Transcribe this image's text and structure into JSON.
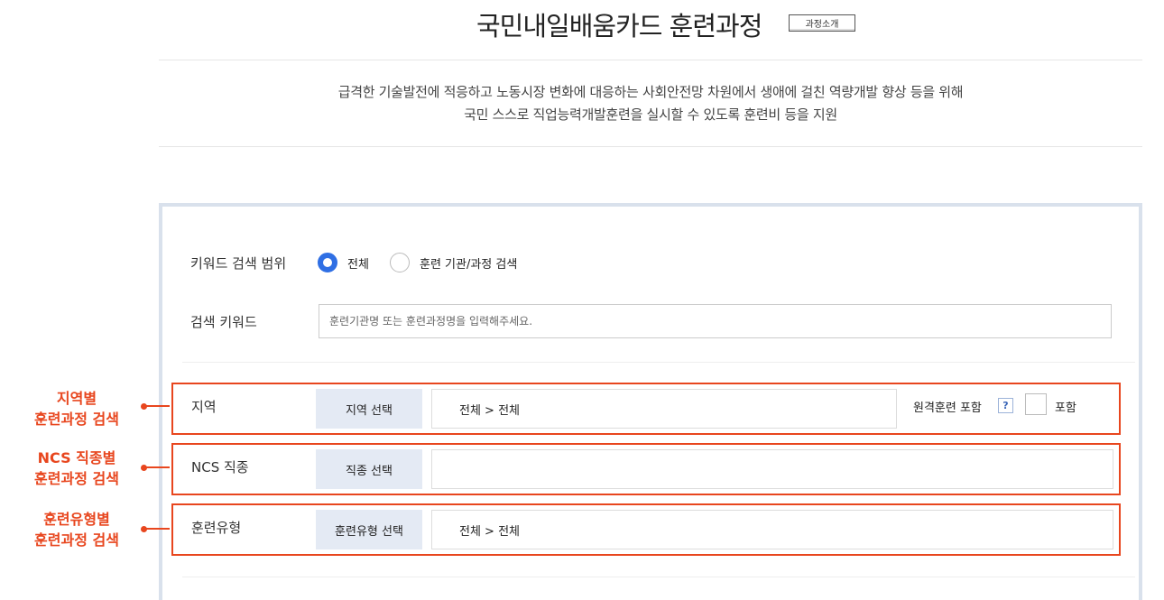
{
  "header": {
    "title": "국민내일배움카드 훈련과정",
    "intro_button": "과정소개",
    "description_line1": "급격한 기술발전에 적응하고 노동시장 변화에 대응하는 사회안전망 차원에서 생애에 걸친 역량개발 향상 등을 위해",
    "description_line2": "국민 스스로 직업능력개발훈련을 실시할 수 있도록 훈련비 등을 지원"
  },
  "search": {
    "scope_label": "키워드 검색 범위",
    "scope_options": [
      {
        "label": "전체",
        "selected": true
      },
      {
        "label": "훈련 기관/과정 검색",
        "selected": false
      }
    ],
    "keyword_label": "검색 키워드",
    "keyword_placeholder": "훈련기관명 또는 훈련과정명을 입력해주세요.",
    "keyword_value": ""
  },
  "filters": {
    "region": {
      "label": "지역",
      "button": "지역 선택",
      "value": "전체 > 전체",
      "remote_label": "원격훈련 포함",
      "help": "?",
      "checkbox_label": "포함",
      "checked": false
    },
    "ncs": {
      "label": "NCS 직종",
      "button": "직종 선택",
      "value": ""
    },
    "type": {
      "label": "훈련유형",
      "button": "훈련유형 선택",
      "value": "전체 > 전체"
    }
  },
  "annotations": {
    "region": {
      "line1": "지역별",
      "line2": "훈련과정 검색"
    },
    "ncs": {
      "line1": "NCS 직종별",
      "line2": "훈련과정 검색"
    },
    "type": {
      "line1": "훈련유형별",
      "line2": "훈련과정 검색"
    },
    "color": "#e8461e"
  },
  "colors": {
    "accent": "#2f6fe4",
    "panel_border": "#d9e1ec",
    "button_bg": "#e4eaf4"
  }
}
